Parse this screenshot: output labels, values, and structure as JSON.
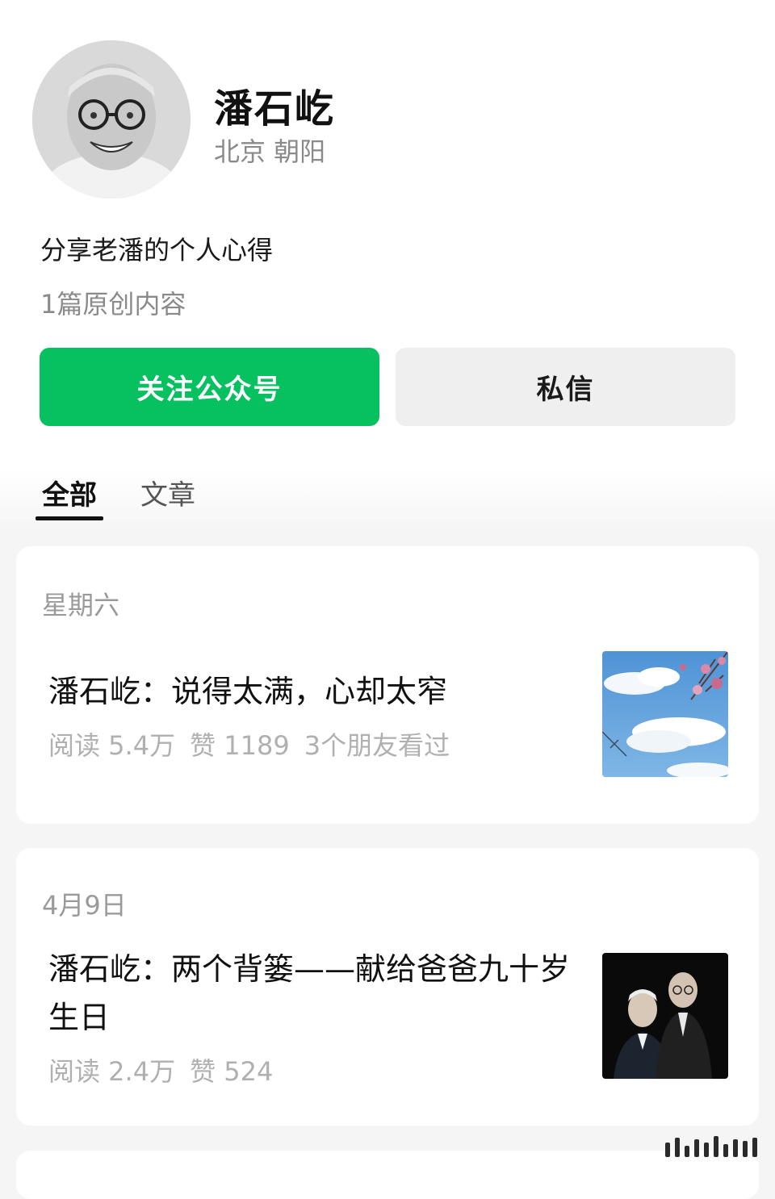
{
  "profile": {
    "name": "潘石屹",
    "location": "北京 朝阳",
    "bio": "分享老潘的个人心得",
    "original_count": "1篇原创内容"
  },
  "actions": {
    "follow_label": "关注公众号",
    "message_label": "私信"
  },
  "tabs": [
    {
      "label": "全部",
      "active": true
    },
    {
      "label": "文章",
      "active": false
    }
  ],
  "articles": [
    {
      "date": "星期六",
      "title": "潘石屹：说得太满，心却太窄",
      "reads": "阅读 5.4万",
      "likes": "赞 1189",
      "friends": "3个朋友看过",
      "thumbnail": "sky-clouds-blossom-image"
    },
    {
      "date": "4月9日",
      "title": "潘石屹：两个背篓——献给爸爸九十岁生日",
      "reads": "阅读 2.4万",
      "likes": "赞 524",
      "thumbnail": "father-son-portrait-image"
    }
  ],
  "colors": {
    "primary_green": "#07c160",
    "secondary_gray": "#efefef",
    "muted_text": "#8a8a8a"
  }
}
